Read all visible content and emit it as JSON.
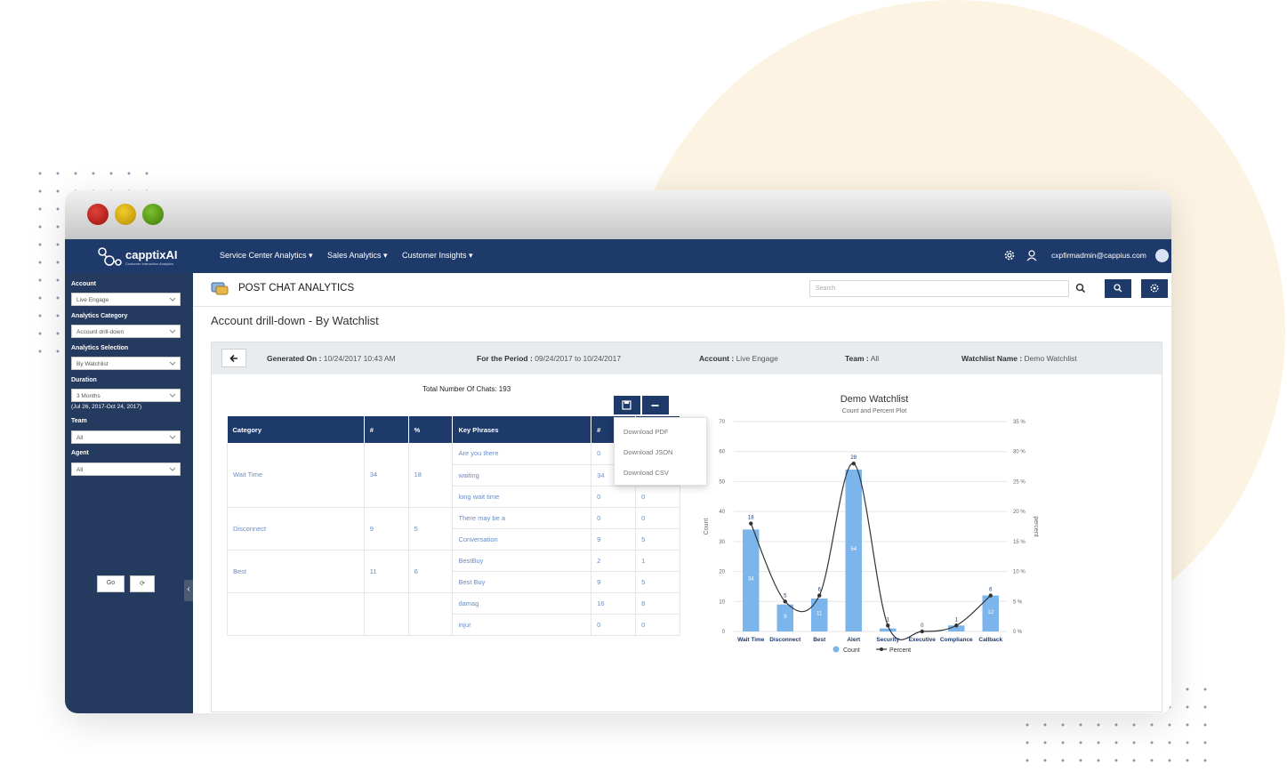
{
  "app": {
    "logo_text": "capptixAI",
    "logo_sub": "Customer Interaction Analytics"
  },
  "nav": {
    "menus": [
      "Service Center Analytics",
      "Sales Analytics",
      "Customer Insights"
    ],
    "user_email": "cxpfirmadmin@cappius.com",
    "icons": [
      "gear-icon",
      "user-icon"
    ]
  },
  "sidebar": {
    "fields": [
      {
        "label": "Account",
        "value": "Live Engage"
      },
      {
        "label": "Analytics Category",
        "value": "Account drill-down"
      },
      {
        "label": "Analytics Selection",
        "value": "By Watchlist"
      },
      {
        "label": "Duration",
        "value": "3 Months"
      },
      {
        "label": "Team",
        "value": "All"
      },
      {
        "label": "Agent",
        "value": "All"
      }
    ],
    "duration_note": "(Jul 26, 2017-Oct 24, 2017)",
    "go_label": "Go",
    "refresh_label": "⟳"
  },
  "header": {
    "title": "POST CHAT ANALYTICS",
    "search_placeholder": "Search"
  },
  "subtitle": "Account drill-down - By Watchlist",
  "info": {
    "generated_label": "Generated On :",
    "generated_value": "10/24/2017 10:43 AM",
    "period_label": "For the Period :",
    "period_value": "09/24/2017 to 10/24/2017",
    "account_label": "Account :",
    "account_value": "Live Engage",
    "team_label": "Team :",
    "team_value": "All",
    "watchlist_label": "Watchlist Name :",
    "watchlist_value": "Demo Watchlist"
  },
  "total_chats": "Total Number Of Chats: 193",
  "table": {
    "headers": [
      "Category",
      "#",
      "%",
      "Key Phrases",
      "#",
      "%"
    ],
    "groups": [
      {
        "category": "Wait Time",
        "count": "34",
        "pct": "18",
        "phrases": [
          [
            "Are you there",
            "0",
            "0"
          ],
          [
            "waiting",
            "34",
            "18"
          ],
          [
            "long wait time",
            "0",
            "0"
          ]
        ]
      },
      {
        "category": "Disconnect",
        "count": "9",
        "pct": "5",
        "phrases": [
          [
            "There may be a",
            "0",
            "0"
          ],
          [
            "Conversation",
            "9",
            "5"
          ]
        ]
      },
      {
        "category": "Best",
        "count": "11",
        "pct": "6",
        "phrases": [
          [
            "BestBuy",
            "2",
            "1"
          ],
          [
            "Best Buy",
            "9",
            "5"
          ],
          [
            "damag",
            "16",
            "8"
          ],
          [
            "injur",
            "0",
            "0"
          ]
        ]
      }
    ]
  },
  "download_menu": [
    "Download PDF",
    "Download JSON",
    "Download CSV"
  ],
  "chart_data": {
    "type": "bar",
    "title": "Demo Watchlist",
    "subtitle": "Count and Percent Plot",
    "categories": [
      "Wait Time",
      "Disconnect",
      "Best",
      "Alert",
      "Security",
      "Executive",
      "Compliance",
      "Callback"
    ],
    "series": [
      {
        "name": "Count",
        "type": "bar",
        "values": [
          34,
          9,
          11,
          54,
          1,
          0,
          2,
          12
        ]
      },
      {
        "name": "Percent",
        "type": "line",
        "values": [
          18,
          5,
          6,
          28,
          1,
          0,
          1,
          6
        ]
      }
    ],
    "ylabel": "Count",
    "y2label": "percent",
    "ylim": [
      0,
      70
    ],
    "y2lim": [
      0,
      35
    ],
    "yticks": [
      "0",
      "10",
      "20",
      "30",
      "40",
      "50",
      "60",
      "70"
    ],
    "y2ticks": [
      "0 %",
      "5 %",
      "10 %",
      "15 %",
      "20 %",
      "25 %",
      "30 %",
      "35 %"
    ],
    "legend": "bottom",
    "colors": {
      "bar": "#7cb5ec",
      "line": "#333333"
    }
  }
}
